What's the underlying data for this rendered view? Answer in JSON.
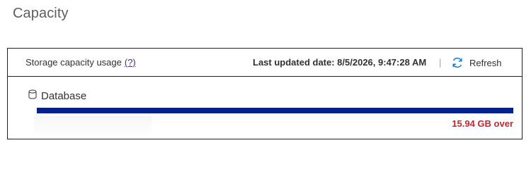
{
  "page": {
    "title": "Capacity"
  },
  "card": {
    "usage_label": "Storage capacity usage",
    "help_link": "(?)",
    "last_updated": "Last updated date: 8/5/2026, 9:47:28 AM",
    "separator": "|",
    "refresh_label": "Refresh",
    "refresh_icon": "refresh-icon",
    "database": {
      "icon": "database-icon",
      "label": "Database",
      "usage_fraction": 1.0,
      "bar_color": "#002095",
      "status_text": "15.94 GB over",
      "status_color": "#c8262e"
    }
  }
}
